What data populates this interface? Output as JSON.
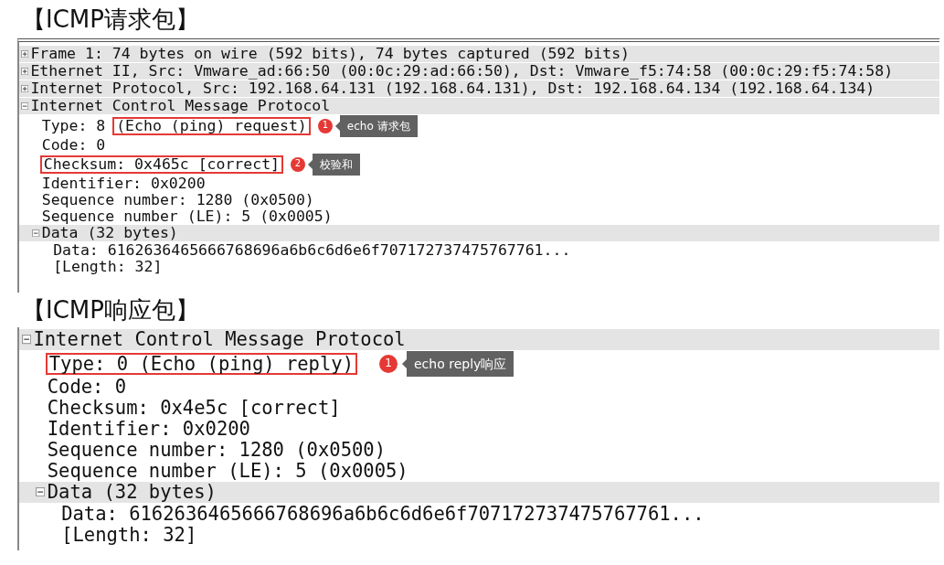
{
  "sections": [
    {
      "heading": "【ICMP请求包】",
      "tree": [
        {
          "text": "Frame 1: 74 bytes on wire (592 bits), 74 bytes captured (592 bits)",
          "expanded": false
        },
        {
          "text": "Ethernet II, Src: Vmware_ad:66:50 (00:0c:29:ad:66:50), Dst: Vmware_f5:74:58 (00:0c:29:f5:74:58)",
          "expanded": false
        },
        {
          "text": "Internet Protocol, Src: 192.168.64.131 (192.168.64.131), Dst: 192.168.64.134 (192.168.64.134)",
          "expanded": false
        },
        {
          "text": "Internet Control Message Protocol",
          "expanded": true,
          "children": [
            {
              "text": "Type: 8",
              "boxed": "(Echo (ping) request)",
              "callout": {
                "number": "1",
                "label": "echo 请求包"
              }
            },
            {
              "text": "Code: 0"
            },
            {
              "boxed": "Checksum: 0x465c [correct]",
              "callout": {
                "number": "2",
                "label": "校验和"
              }
            },
            {
              "text": "Identifier: 0x0200"
            },
            {
              "text": "Sequence number: 1280 (0x0500)"
            },
            {
              "text": "Sequence number (LE): 5 (0x0005)"
            },
            {
              "text": "Data (32 bytes)",
              "expanded": true,
              "children": [
                {
                  "text": "Data: 6162636465666768696a6b6c6d6e6f707172737475767761..."
                },
                {
                  "text": "[Length: 32]"
                }
              ]
            }
          ]
        }
      ]
    },
    {
      "heading": "【ICMP响应包】",
      "tree": [
        {
          "text": "Internet Control Message Protocol",
          "expanded": true,
          "children": [
            {
              "boxed": "Type: 0 (Echo (ping) reply)",
              "callout": {
                "number": "1",
                "label": "echo reply响应"
              }
            },
            {
              "text": "Code: 0"
            },
            {
              "text": "Checksum: 0x4e5c [correct]"
            },
            {
              "text": "Identifier: 0x0200"
            },
            {
              "text": "Sequence number: 1280 (0x0500)"
            },
            {
              "text": "Sequence number (LE): 5 (0x0005)"
            },
            {
              "text": "Data (32 bytes)",
              "expanded": true,
              "children": [
                {
                  "text": "Data: 6162636465666768696a6b6c6d6e6f707172737475767761..."
                },
                {
                  "text": "[Length: 32]"
                }
              ]
            }
          ]
        }
      ]
    }
  ]
}
